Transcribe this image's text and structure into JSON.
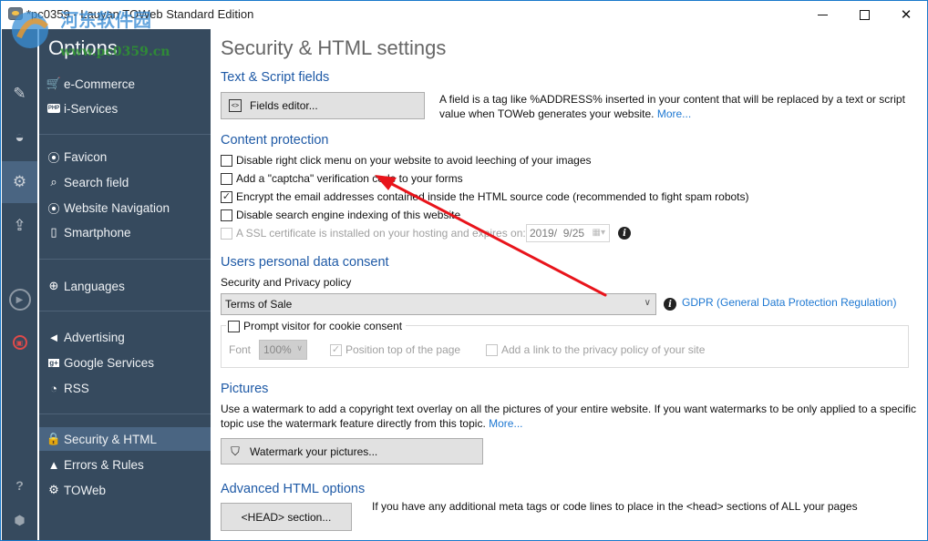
{
  "window": {
    "title": "*pc0359 - Lauyan TOWeb Standard Edition",
    "controls": {
      "minimize": "minimize",
      "maximize": "maximize",
      "close": "✕"
    }
  },
  "watermark": {
    "text_cn": "河东软件园",
    "url": "www.pc0359.cn"
  },
  "iconbar": {
    "items": [
      {
        "icon": "pencil-icon",
        "glyph": "✎"
      },
      {
        "icon": "paint-bucket-icon",
        "glyph": "◒"
      },
      {
        "icon": "gears-icon",
        "glyph": "⚙",
        "active": true
      },
      {
        "icon": "upload-icon",
        "glyph": "⇪"
      },
      {
        "icon": "play-icon",
        "glyph": "▶"
      },
      {
        "icon": "save-icon",
        "glyph": "▣"
      },
      {
        "icon": "help-icon",
        "glyph": "?"
      },
      {
        "icon": "shield-icon",
        "glyph": "⬢"
      }
    ]
  },
  "sidebar": {
    "title": "Options",
    "items": [
      {
        "label": "e-Commerce",
        "icon": "cart-icon",
        "glyph": "🛒"
      },
      {
        "label": "i-Services",
        "icon": "php-icon",
        "glyph": "PHP"
      },
      {
        "label": "Favicon",
        "icon": "compass-icon",
        "glyph": "⦿"
      },
      {
        "label": "Search field",
        "icon": "search-icon",
        "glyph": "⌕"
      },
      {
        "label": "Website Navigation",
        "icon": "compass-icon",
        "glyph": "⦿"
      },
      {
        "label": "Smartphone",
        "icon": "smartphone-icon",
        "glyph": "▯"
      },
      {
        "label": "Languages",
        "icon": "globe-icon",
        "glyph": "⊕"
      },
      {
        "label": "Advertising",
        "icon": "megaphone-icon",
        "glyph": "◄"
      },
      {
        "label": "Google Services",
        "icon": "google-plus-icon",
        "glyph": "g+"
      },
      {
        "label": "RSS",
        "icon": "rss-icon",
        "glyph": "◔"
      },
      {
        "label": "Security & HTML",
        "icon": "lock-icon",
        "glyph": "■",
        "active": true
      },
      {
        "label": "Errors & Rules",
        "icon": "warning-icon",
        "glyph": "▲"
      },
      {
        "label": "TOWeb",
        "icon": "gear-icon",
        "glyph": "⚙"
      }
    ]
  },
  "main": {
    "title": "Security & HTML settings",
    "text_script": {
      "heading": "Text & Script fields",
      "button": "Fields editor...",
      "desc_line1": "A field is a tag like %ADDRESS% inserted in your content that will be replaced by a text or script",
      "desc_line2": "value when TOWeb generates your website.",
      "more": "More..."
    },
    "content_protection": {
      "heading": "Content protection",
      "options": [
        {
          "label": "Disable right click menu on your website to avoid leeching of your images",
          "checked": false,
          "enabled": true
        },
        {
          "label": "Add a \"captcha\" verification code to your forms",
          "checked": false,
          "enabled": true
        },
        {
          "label": "Encrypt the email addresses contained inside the HTML source code (recommended to fight spam robots)",
          "checked": true,
          "enabled": true
        },
        {
          "label": "Disable search engine indexing of this website",
          "checked": false,
          "enabled": true
        },
        {
          "label": "A SSL certificate is installed on your hosting and expires on:",
          "checked": false,
          "enabled": false
        }
      ],
      "ssl_date": "2019/  9/25"
    },
    "consent": {
      "heading": "Users personal data consent",
      "policy_label": "Security and Privacy policy",
      "policy_selected": "Terms of Sale",
      "gdpr_link": "GDPR (General Data Protection Regulation)",
      "cookie_prompt": {
        "label": "Prompt visitor for cookie consent",
        "checked": false
      },
      "font_label": "Font",
      "font_value": "100%",
      "position_top": {
        "label": "Position top of the page",
        "checked": true,
        "enabled": false
      },
      "privacy_link": {
        "label": "Add a link to the privacy policy of your site",
        "checked": false,
        "enabled": false
      }
    },
    "pictures": {
      "heading": "Pictures",
      "desc_line1": "Use a watermark to add a copyright text overlay on all the pictures of your entire website. If you want watermarks to be only applied to a specific",
      "desc_line2": "topic use the watermark feature directly from this topic.",
      "more": "More...",
      "button": "Watermark your pictures..."
    },
    "advanced": {
      "heading": "Advanced HTML options",
      "button": "<HEAD> section...",
      "desc": "If you have any additional meta tags or code lines to place in the <head> sections of ALL your pages"
    }
  },
  "annotation": {
    "type": "red-arrow",
    "color": "#e8141b"
  }
}
